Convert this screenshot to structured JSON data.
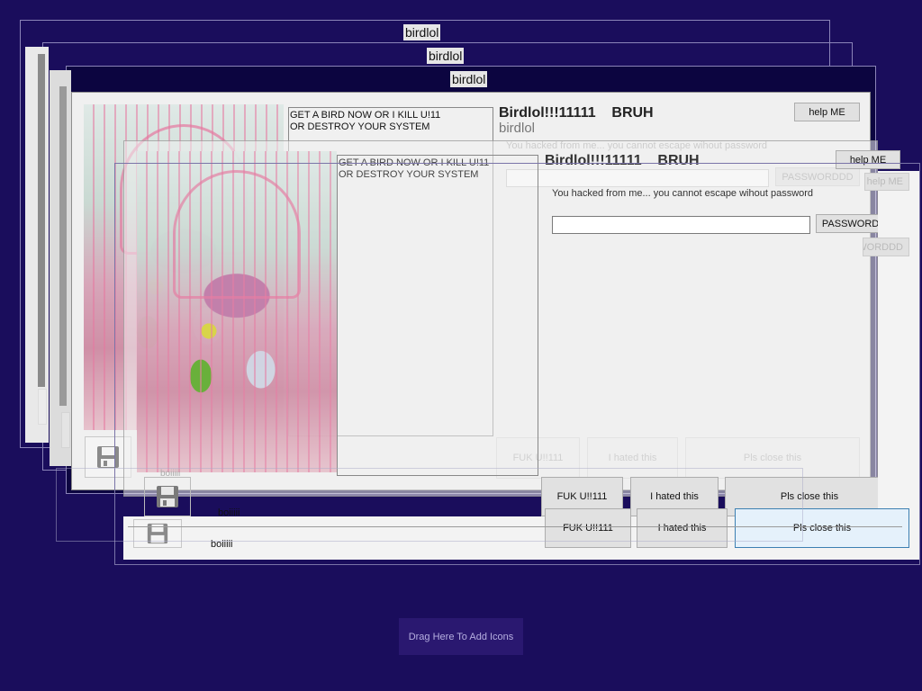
{
  "windows": [
    {
      "title": "birdlol"
    },
    {
      "title": "birdlol"
    },
    {
      "title": "birdlol"
    }
  ],
  "main": {
    "memo_line1": "GET A BIRD NOW OR I KILL U!11",
    "memo_line2": "OR DESTROY YOUR SYSTEM",
    "heading": "Birdlol!!!11111    BRUH",
    "subtitle": "birdlol",
    "message": "You hacked from me... you cannot escape wihout password",
    "help_button": "help ME",
    "password_button": "PASSWORDDD",
    "password_value": "",
    "btn_fuk": "FUK U!!111",
    "btn_hated": "I hated this",
    "btn_close": "Pls close this",
    "boi_label": "boiiiii"
  },
  "desktop": {
    "drop_zone": "Drag Here To Add Icons"
  },
  "colors": {
    "desktop_bg": "#1a0d5c",
    "window_bg": "#f0f0f0",
    "title_bg": "#e6e6e6"
  }
}
